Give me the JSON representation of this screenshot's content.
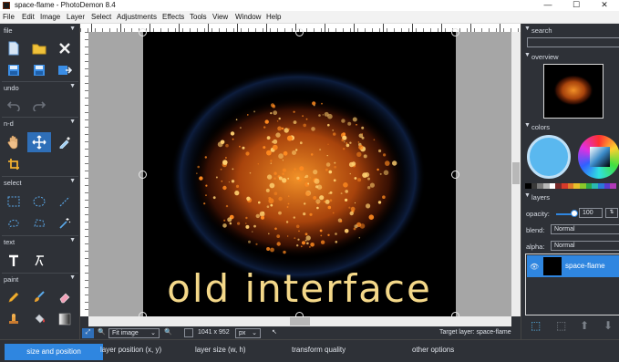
{
  "window": {
    "title": "space-flame  -  PhotoDemon 8.4",
    "minimize": "—",
    "maximize": "☐",
    "close": "✕"
  },
  "menu": [
    "File",
    "Edit",
    "Image",
    "Layer",
    "Select",
    "Adjustments",
    "Effects",
    "Tools",
    "View",
    "Window",
    "Help"
  ],
  "toolbox": {
    "sections": {
      "file": "file",
      "undo": "undo",
      "nd": "n-d",
      "select": "select",
      "text": "text",
      "paint": "paint"
    }
  },
  "ruler_labels": [
    "0",
    "100",
    "200",
    "300",
    "400",
    "500",
    "600",
    "700",
    "800",
    "900",
    "1000",
    "1100",
    "1200",
    "1300",
    "1400"
  ],
  "canvas": {
    "overlay_text": "old interface"
  },
  "statusbar": {
    "zoom_value": "Fit image",
    "image_size": "1041 x 952",
    "unit": "px",
    "target_layer": "Target layer: space-flame"
  },
  "right_panel": {
    "search_header": "search",
    "overview_header": "overview",
    "colors_header": "colors",
    "layers_header": "layers",
    "opacity_label": "opacity:",
    "opacity_value": "100",
    "blend_label": "blend:",
    "blend_value": "Normal",
    "alpha_label": "alpha:",
    "alpha_value": "Normal",
    "layer_name": "space-flame"
  },
  "options_bar": {
    "active_tab": "size and position",
    "layer_position_label": "layer position (x, y)",
    "layer_size_label": "layer size (w, h)",
    "transform_quality_label": "transform quality",
    "other_options_label": "other options"
  },
  "colors": {
    "accent": "#2f86e0",
    "active_tool": "#2f6fb8",
    "panel_bg": "#2e3137",
    "text": "#f4d889",
    "swatch_primary": "#5ab8ef"
  },
  "palette_swatches": [
    "#000000",
    "#3a3a3a",
    "#7a7a7a",
    "#b8b8b8",
    "#ffffff",
    "#7a2a2a",
    "#d63a2a",
    "#e07a2a",
    "#e8c02a",
    "#8ac82a",
    "#2aa84a",
    "#2ab8b0",
    "#2a78d8",
    "#5a3ad0",
    "#b03ab8"
  ]
}
